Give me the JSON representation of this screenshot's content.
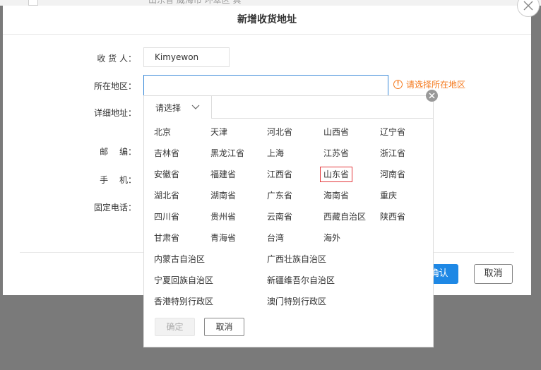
{
  "background": {
    "partial_text": "山东省 威海市 环翠区 真"
  },
  "dialog": {
    "title": "新增收货地址",
    "labels": {
      "consignee": "收 货 人：",
      "region": "所在地区：",
      "detail": "详细地址：",
      "postcode": "邮　 编：",
      "mobile": "手　 机：",
      "phone": "固定电话："
    },
    "consignee_value": "Kimyewon",
    "region_tip": "请选择所在地区",
    "confirm_label": "确认",
    "cancel_label": "取消"
  },
  "picker": {
    "tab_label": "请选择",
    "provinces": [
      "北京",
      "天津",
      "河北省",
      "山西省",
      "辽宁省",
      "吉林省",
      "黑龙江省",
      "上海",
      "江苏省",
      "浙江省",
      "安徽省",
      "福建省",
      "江西省",
      "山东省",
      "河南省",
      "湖北省",
      "湖南省",
      "广东省",
      "海南省",
      "重庆",
      "四川省",
      "贵州省",
      "云南省",
      "西藏自治区",
      "陕西省",
      "甘肃省",
      "青海省",
      "台湾",
      "海外"
    ],
    "wide_regions": [
      "内蒙古自治区",
      "广西壮族自治区",
      "宁夏回族自治区",
      "新疆维吾尔自治区",
      "香港特别行政区",
      "澳门特别行政区"
    ],
    "selected": "山东省",
    "ok_label": "确定",
    "cancel_label": "取消"
  },
  "colors": {
    "accent": "#1e88e5",
    "warning": "#f57a1e",
    "selected_border": "#e4393c"
  }
}
